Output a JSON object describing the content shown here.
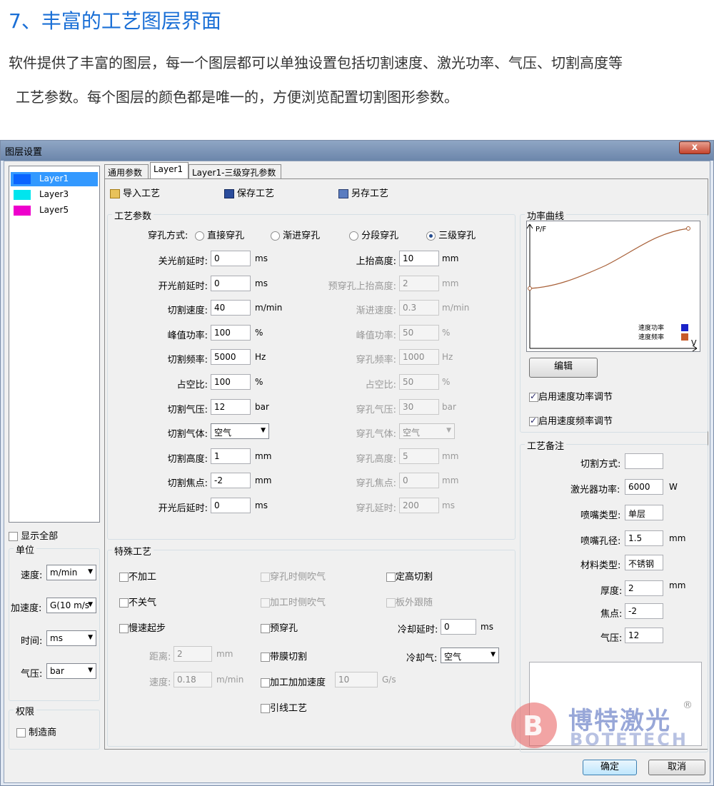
{
  "heading": "7、丰富的工艺图层界面",
  "intro_line1": "软件提供了丰富的图层，每一个图层都可以单独设置包括切割速度、激光功率、气压、切割高度等",
  "intro_line2": "工艺参数。每个图层的颜色都是唯一的，方便浏览配置切割图形参数。",
  "window": {
    "title": "图层设置",
    "close": "x"
  },
  "layers": [
    {
      "label": "Layer1",
      "color": "#0a64ff",
      "selected": true
    },
    {
      "label": "Layer3",
      "color": "#00e5ee",
      "selected": false
    },
    {
      "label": "Layer5",
      "color": "#ee00cc",
      "selected": false
    }
  ],
  "show_all": "显示全部",
  "units": {
    "title": "单位",
    "speed_label": "速度:",
    "speed_value": "m/min",
    "accel_label": "加速度:",
    "accel_value": "G(10 m/s",
    "time_label": "时间:",
    "time_value": "ms",
    "pressure_label": "气压:",
    "pressure_value": "bar"
  },
  "permission": {
    "title": "权限",
    "manufacturer": "制造商"
  },
  "tabs": [
    "通用参数",
    "Layer1",
    "Layer1-三级穿孔参数"
  ],
  "toolbar": {
    "import": "导入工艺",
    "save": "保存工艺",
    "save_as": "另存工艺"
  },
  "process": {
    "title": "工艺参数",
    "pierce_label": "穿孔方式:",
    "pierce_options": [
      "直接穿孔",
      "渐进穿孔",
      "分段穿孔",
      "三级穿孔"
    ],
    "pierce_selected": 3,
    "left": [
      {
        "label": "关光前延时:",
        "value": "0",
        "unit": "ms"
      },
      {
        "label": "开光前延时:",
        "value": "0",
        "unit": "ms"
      },
      {
        "label": "切割速度:",
        "value": "40",
        "unit": "m/min"
      },
      {
        "label": "峰值功率:",
        "value": "100",
        "unit": "%"
      },
      {
        "label": "切割频率:",
        "value": "5000",
        "unit": "Hz"
      },
      {
        "label": "占空比:",
        "value": "100",
        "unit": "%"
      },
      {
        "label": "切割气压:",
        "value": "12",
        "unit": "bar"
      },
      {
        "label": "切割气体:",
        "value": "空气",
        "unit": ""
      },
      {
        "label": "切割高度:",
        "value": "1",
        "unit": "mm"
      },
      {
        "label": "切割焦点:",
        "value": "-2",
        "unit": "mm"
      },
      {
        "label": "开光后延时:",
        "value": "0",
        "unit": "ms"
      }
    ],
    "right": [
      {
        "label": "上抬高度:",
        "value": "10",
        "unit": "mm"
      },
      {
        "label": "预穿孔上抬高度:",
        "value": "2",
        "unit": "mm"
      },
      {
        "label": "渐进速度:",
        "value": "0.3",
        "unit": "m/min"
      },
      {
        "label": "峰值功率:",
        "value": "50",
        "unit": "%"
      },
      {
        "label": "穿孔频率:",
        "value": "1000",
        "unit": "Hz"
      },
      {
        "label": "占空比:",
        "value": "50",
        "unit": "%"
      },
      {
        "label": "穿孔气压:",
        "value": "30",
        "unit": "bar"
      },
      {
        "label": "穿孔气体:",
        "value": "空气",
        "unit": ""
      },
      {
        "label": "穿孔高度:",
        "value": "5",
        "unit": "mm"
      },
      {
        "label": "穿孔焦点:",
        "value": "0",
        "unit": "mm"
      },
      {
        "label": "穿孔延时:",
        "value": "200",
        "unit": "ms"
      }
    ]
  },
  "special": {
    "title": "特殊工艺",
    "no_process": "不加工",
    "no_shutter": "不关气",
    "slow_start": "慢速起步",
    "distance_label": "距离:",
    "distance_value": "2",
    "distance_unit": "mm",
    "speed_label": "速度:",
    "speed_value": "0.18",
    "speed_unit": "m/min",
    "blow_pierce": "穿孔时侧吹气",
    "blow_process": "加工时侧吹气",
    "pre_pierce": "预穿孔",
    "film_cut": "带膜切割",
    "accel": "加工加加速度",
    "accel_value": "10",
    "accel_unit": "G/s",
    "lead_line": "引线工艺",
    "fixed_height": "定高切割",
    "outside_follow": "板外跟随",
    "cool_delay_label": "冷却延时:",
    "cool_delay_value": "0",
    "cool_delay_unit": "ms",
    "cool_gas_label": "冷却气:",
    "cool_gas_value": "空气"
  },
  "power_curve": {
    "title": "功率曲线",
    "y_axis": "P/F",
    "x_axis": "V",
    "legend_power": "速度功率",
    "legend_freq": "速度频率",
    "power_color": "#1a22c8",
    "freq_color": "#c85a28",
    "edit_button": "编辑",
    "enable_power": "启用速度功率调节",
    "enable_freq": "启用速度频率调节"
  },
  "notes": {
    "title": "工艺备注",
    "cut_mode_label": "切割方式:",
    "cut_mode_value": "",
    "laser_power_label": "激光器功率:",
    "laser_power_value": "6000",
    "laser_power_unit": "W",
    "nozzle_type_label": "喷嘴类型:",
    "nozzle_type_value": "单层",
    "nozzle_dia_label": "喷嘴孔径:",
    "nozzle_dia_value": "1.5",
    "nozzle_dia_unit": "mm",
    "material_label": "材料类型:",
    "material_value": "不锈钢",
    "thickness_label": "厚度:",
    "thickness_value": "2",
    "thickness_unit": "mm",
    "focus_label": "焦点:",
    "focus_value": "-2",
    "pressure_label": "气压:",
    "pressure_value": "12"
  },
  "watermark": {
    "cn": "博特激光",
    "en": "BOTETECH",
    "reg": "®"
  },
  "buttons": {
    "ok": "确定",
    "cancel": "取消"
  }
}
